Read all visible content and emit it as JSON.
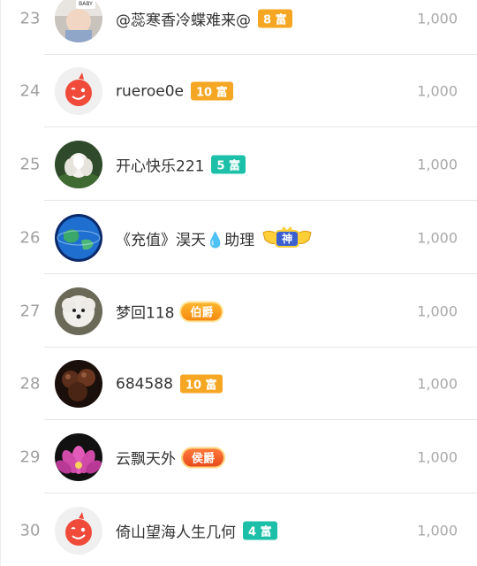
{
  "ranking": {
    "rows": [
      {
        "rank": "23",
        "name": "@蕊寒香冷蝶难来@",
        "badge": "8 富",
        "score": "1,000",
        "badge_color": "#f5a623",
        "avatar": "baby-photo"
      },
      {
        "rank": "24",
        "name": "rueroe0e",
        "badge": "10 富",
        "score": "1,000",
        "badge_color": "#f5a623",
        "avatar": "default-red-avatar"
      },
      {
        "rank": "25",
        "name": "开心快乐221",
        "badge": "5 富",
        "score": "1,000",
        "badge_color": "#1cc0a8",
        "avatar": "lotus-photo"
      },
      {
        "rank": "26",
        "name": "《充值》淏天💧助理",
        "badge": "神",
        "score": "1,000",
        "badge_color": "#3a5fd0",
        "avatar": "earth-photo"
      },
      {
        "rank": "27",
        "name": "梦回118",
        "badge": "伯爵",
        "score": "1,000",
        "badge_color": "#f58a10",
        "avatar": "puppy-photo"
      },
      {
        "rank": "28",
        "name": "684588",
        "badge": "10 富",
        "score": "1,000",
        "badge_color": "#f5a623",
        "avatar": "chestnut-photo"
      },
      {
        "rank": "29",
        "name": "云飘天外",
        "badge": "侯爵",
        "score": "1,000",
        "badge_color": "#e84a1a",
        "avatar": "pink-lotus-photo"
      },
      {
        "rank": "30",
        "name": "倚山望海人生几何",
        "badge": "4 富",
        "score": "1,000",
        "badge_color": "#1cc0a8",
        "avatar": "default-red-avatar"
      }
    ]
  }
}
